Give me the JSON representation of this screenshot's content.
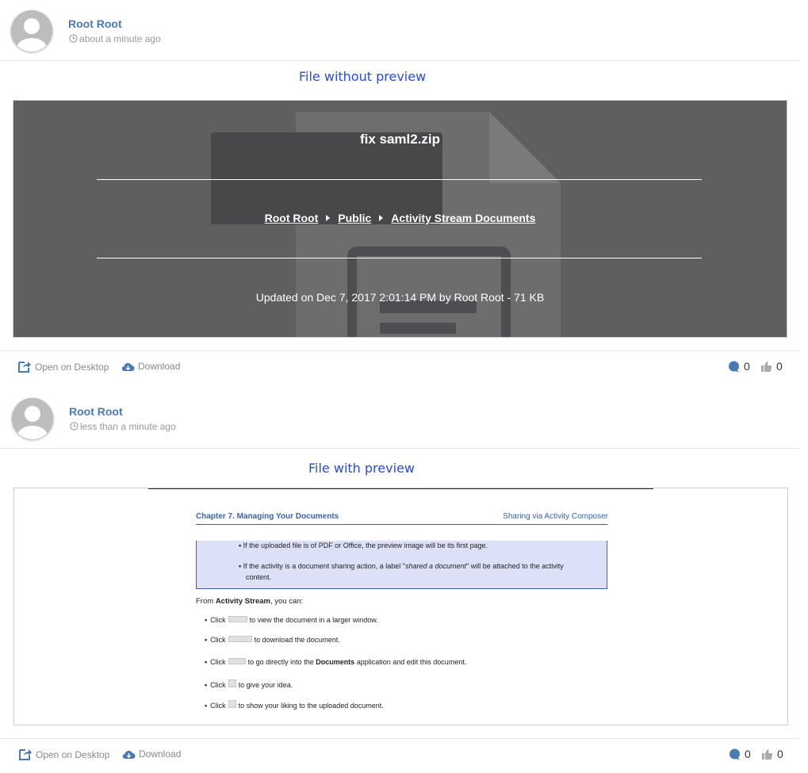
{
  "post1": {
    "author": "Root Root",
    "time": "about a minute ago",
    "caption": "File without preview",
    "file_name": "fix saml2.zip",
    "breadcrumb": [
      "Root Root",
      "Public",
      "Activity Stream Documents"
    ],
    "updated": "Updated on Dec 7, 2017 2:01:14 PM by Root Root - 71 KB",
    "actions": {
      "open_desktop": "Open on Desktop",
      "download": "Download"
    },
    "comments": "0",
    "likes": "0"
  },
  "post2": {
    "author": "Root Root",
    "time": "less than a minute ago",
    "caption": "File with preview",
    "doc": {
      "chapter": "Chapter 7. Managing Your Documents",
      "section": "Sharing via Activity Composer",
      "note1": "If the uploaded file is of PDF or Office, the preview image will be its first page.",
      "note2_a": "If the activity is a document sharing action, a label \"",
      "note2_em": "shared a document",
      "note2_b": "\" will be attached to the activity",
      "note2_c": "content.",
      "from_a": "From ",
      "from_b": "Activity Stream",
      "from_c": ", you can:",
      "click": "Click",
      "b1": "to view the document in a larger window.",
      "b2": "to download the document.",
      "b3_a": "to go directly into the ",
      "b3_b": "Documents",
      "b3_c": " application and edit this document.",
      "b4": "to give your idea.",
      "b5": "to show your liking to the uploaded document."
    },
    "actions": {
      "open_desktop": "Open on Desktop",
      "download": "Download"
    },
    "comments": "0",
    "likes": "0"
  },
  "colors": {
    "link": "#4a7ab5",
    "caption": "#2b4bd8",
    "preview_bg": "#5f5f60",
    "doc_accent": "#3a63b5"
  }
}
